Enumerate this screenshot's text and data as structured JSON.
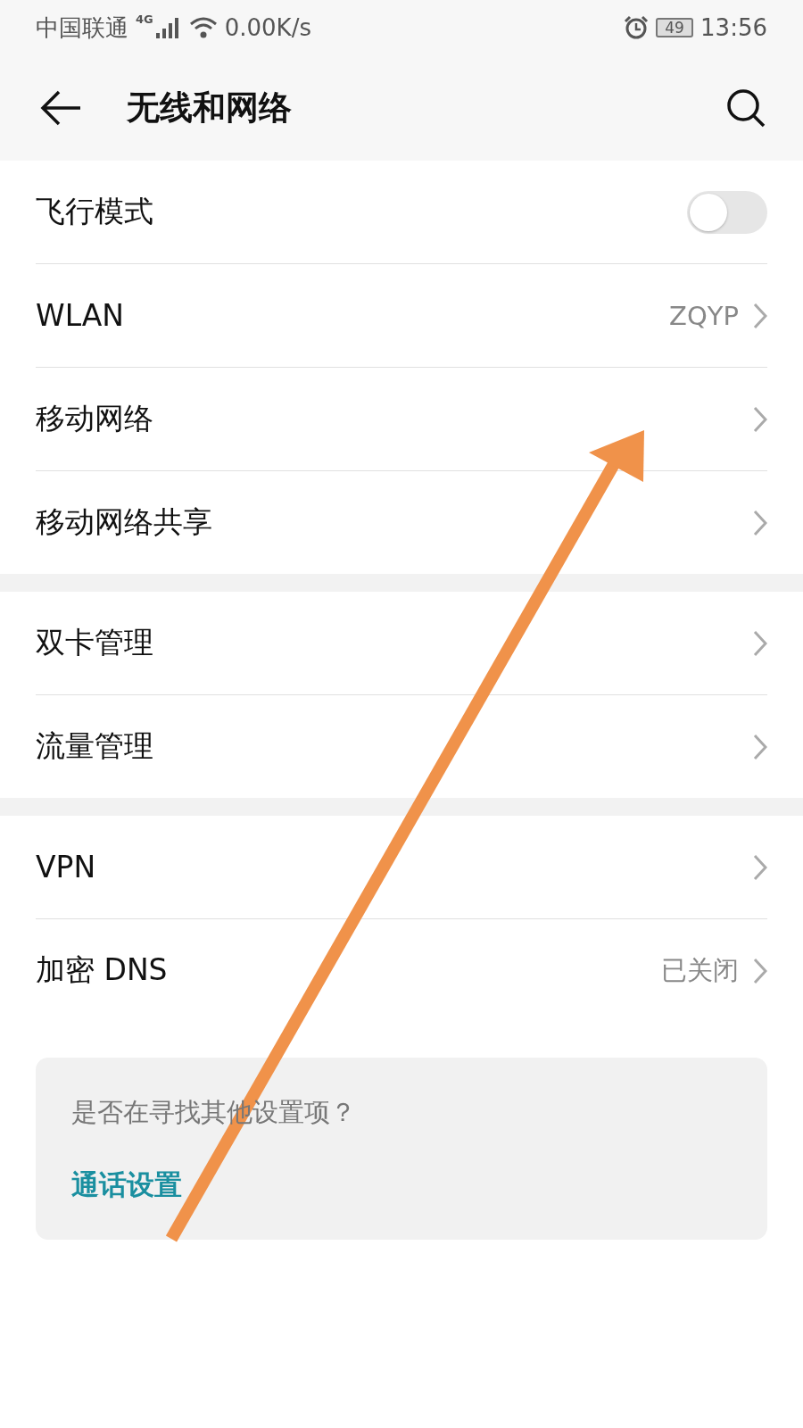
{
  "status_bar": {
    "carrier": "中国联通",
    "network": "4G",
    "speed": "0.00K/s",
    "battery": "49",
    "time": "13:56"
  },
  "header": {
    "title": "无线和网络"
  },
  "sections": [
    {
      "items": [
        {
          "kind": "toggle",
          "label": "飞行模式",
          "on": false
        },
        {
          "kind": "link",
          "label": "WLAN",
          "value": "ZQYP"
        },
        {
          "kind": "link",
          "label": "移动网络"
        },
        {
          "kind": "link",
          "label": "移动网络共享"
        }
      ]
    },
    {
      "items": [
        {
          "kind": "link",
          "label": "双卡管理"
        },
        {
          "kind": "link",
          "label": "流量管理"
        }
      ]
    },
    {
      "items": [
        {
          "kind": "link",
          "label": "VPN"
        },
        {
          "kind": "link",
          "label": "加密 DNS",
          "value": "已关闭"
        }
      ]
    }
  ],
  "suggestion": {
    "prompt": "是否在寻找其他设置项？",
    "link": "通话设置"
  }
}
